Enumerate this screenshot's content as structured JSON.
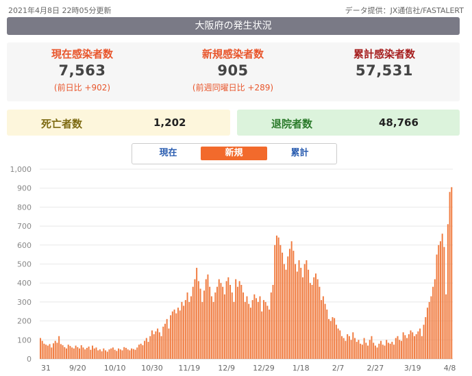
{
  "header": {
    "updated": "2021年4月8日 22時05分更新",
    "source": "データ提供：JX通信社/FASTALERT"
  },
  "title": "大阪府の発生状況",
  "stats": {
    "current": {
      "label": "現在感染者数",
      "value": "7,563",
      "sub": "(前日比 +902)"
    },
    "new": {
      "label": "新規感染者数",
      "value": "905",
      "sub": "(前週同曜日比 +289)"
    },
    "total": {
      "label": "累計感染者数",
      "value": "57,531"
    }
  },
  "deaths": {
    "label": "死亡者数",
    "value": "1,202"
  },
  "recovered": {
    "label": "退院者数",
    "value": "48,766"
  },
  "tabs": [
    {
      "label": "現在",
      "active": false
    },
    {
      "label": "新規",
      "active": true
    },
    {
      "label": "累計",
      "active": false
    }
  ],
  "colors": {
    "accent": "#f26a2c",
    "bar": "#f07b3f",
    "current_label": "#e8552b",
    "total_label": "#a61f1f",
    "deaths_label": "#7d6a12",
    "recovered_label": "#2a7a2a"
  },
  "chart_data": {
    "type": "bar",
    "title": "",
    "xlabel": "",
    "ylabel": "",
    "ylim": [
      0,
      1000
    ],
    "yticks": [
      0,
      100,
      200,
      300,
      400,
      500,
      600,
      700,
      800,
      900,
      1000
    ],
    "ytick_labels": [
      "0",
      "100",
      "200",
      "300",
      "400",
      "500",
      "600",
      "700",
      "800",
      "900",
      "1,000"
    ],
    "xtick_labels": [
      {
        "label": "31",
        "index": 0
      },
      {
        "label": "9/20",
        "index": 20
      },
      {
        "label": "10/10",
        "index": 40
      },
      {
        "label": "10/30",
        "index": 60
      },
      {
        "label": "11/19",
        "index": 80
      },
      {
        "label": "12/9",
        "index": 100
      },
      {
        "label": "12/29",
        "index": 120
      },
      {
        "label": "1/18",
        "index": 140
      },
      {
        "label": "2/7",
        "index": 160
      },
      {
        "label": "2/27",
        "index": 180
      },
      {
        "label": "3/19",
        "index": 200
      },
      {
        "label": "4/8",
        "index": 220
      }
    ],
    "values": [
      110,
      95,
      80,
      75,
      70,
      78,
      60,
      82,
      95,
      85,
      120,
      78,
      72,
      62,
      55,
      75,
      68,
      60,
      55,
      70,
      62,
      55,
      72,
      60,
      50,
      58,
      65,
      48,
      70,
      55,
      60,
      45,
      50,
      40,
      55,
      45,
      38,
      50,
      55,
      60,
      48,
      42,
      55,
      50,
      45,
      62,
      58,
      50,
      45,
      55,
      52,
      48,
      60,
      75,
      80,
      72,
      95,
      110,
      90,
      120,
      150,
      130,
      145,
      160,
      140,
      120,
      170,
      185,
      210,
      160,
      230,
      250,
      260,
      240,
      270,
      255,
      300,
      280,
      310,
      350,
      300,
      330,
      380,
      420,
      480,
      410,
      370,
      300,
      360,
      420,
      445,
      380,
      330,
      300,
      350,
      380,
      420,
      400,
      380,
      340,
      410,
      430,
      390,
      350,
      300,
      420,
      380,
      410,
      390,
      350,
      300,
      330,
      290,
      270,
      310,
      340,
      320,
      300,
      330,
      250,
      310,
      300,
      280,
      260,
      350,
      390,
      600,
      650,
      640,
      600,
      560,
      500,
      470,
      540,
      580,
      620,
      570,
      500,
      460,
      520,
      480,
      430,
      500,
      520,
      470,
      400,
      390,
      430,
      450,
      420,
      380,
      310,
      330,
      290,
      260,
      210,
      200,
      220,
      215,
      180,
      160,
      150,
      120,
      110,
      95,
      130,
      120,
      100,
      140,
      110,
      90,
      100,
      80,
      75,
      110,
      85,
      70,
      100,
      120,
      85,
      70,
      60,
      80,
      95,
      75,
      70,
      100,
      85,
      80,
      90,
      75,
      110,
      120,
      100,
      95,
      140,
      125,
      110,
      130,
      150,
      140,
      120,
      130,
      145,
      160,
      120,
      180,
      220,
      270,
      300,
      330,
      380,
      420,
      550,
      600,
      620,
      660,
      590,
      340,
      710,
      880,
      905
    ]
  }
}
